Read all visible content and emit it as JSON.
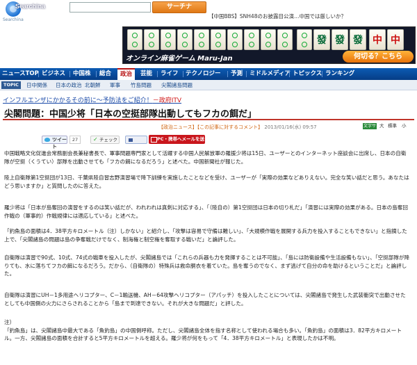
{
  "header": {
    "logo_text": "Searchina",
    "logo_sub": "Searchina",
    "search_button": "サーチナ",
    "ticker": "【中国BBS】SNH48のお披露目公演…中国では厳しいか？"
  },
  "banner": {
    "title": "オンライン麻雀ゲーム Maru-Jan",
    "cta": "何切る？こちら",
    "colors": {
      "bg": "#12182a",
      "cta": "#e8720a"
    }
  },
  "nav": {
    "items": [
      "ニュースTOP",
      "ビジネス",
      "中国株",
      "総合",
      "政治",
      "芸能",
      "ライフ",
      "テクノロジー",
      "予測",
      "ミドルメディア",
      "トピックス",
      "ランキング"
    ],
    "active": "政治"
  },
  "subnav": {
    "label": "TOPIC",
    "items": [
      "日中関係",
      "日本の政治",
      "北朝鮮",
      "軍事",
      "竹島問題",
      "尖閣諸島問題"
    ]
  },
  "promo": {
    "text": "インフルエンザにかかるその前に～予防法をご紹介！",
    "suffix": "－政府ITV"
  },
  "article": {
    "headline": "尖閣問題：中国少将「日本の空挺部隊出動してもフカの餌だ」",
    "meta_source": "【政治ニュース】",
    "meta_comment": "【この記事に対するコメント】",
    "meta_date": "2013/01/16(水) 09:57",
    "font_size_label": "文字サイズ",
    "font_sizes": [
      "大",
      "標準",
      "小"
    ],
    "share": {
      "tweet": "ツイート",
      "tweet_count": "27",
      "check": "チェック",
      "pc_mail": "PC・携帯へメールを送る"
    },
    "paragraphs": [
      "中国戦略文化促進会常務副会長兼秘書長で、軍事問題専門家として活躍する中国人民解放軍の羅援少将は15日、ユーザーとのインターネット座談会に出席し、日本の自衛隊が空挺（くうてい）部隊を出動させても「フカの餌になるだろう」と述べた。中国新聞社が報じた。",
      "陸上自衛隊第1空挺団が13日、千葉県陸自習志野演習場で降下訓練を実施したことなどを受け、ユーザーが「実際の効果などありえない。完全な笑い話だと思う。あなたはどう思いますか」と質問したのに答えた。",
      "羅少将は「日本が島奪回の演習をするのは笑い話だが、われわれは真剣に対応する」、「（陸自の）第1空挺団は日本の切り札だ」「演習には実際の効果がある。日本の島奪回作戦の（軍事的）作戦規律には適応している」と述べた。",
      "「釣魚島の面積は4．38平方キロメートル（注）しかない」と紹介し、「攻撃は容易で守備は難しい」、「大規模作戦を展開する兵力を投入することもできない」と指摘した上で、「尖閣諸島の問題は島の争奪戦だけでなく、制海権と制空権を奪取する戦いだ」と論評した。",
      "自衛隊は演習で90式、10式、74式の戦車を投入したが、尖閣諸島では「これらの兵器も力を発揮することは不可能」、「島には防衛設備や生活設備もない」、「空挺部隊が降りても、水に落ちてフカの餌になるだろう。だから、（自衛隊の）特殊兵は救命胴衣を着ていた。島を奪うのでなく、まず逃げて自分の命を助けるということだ」と論評した。",
      "自衛隊は演習にUH－1多用途ヘリコプター、C－1輸送機、AH－64攻撃ヘリコプター（アパッチ）を投入したことについては、尖閣諸島で発生した武装衝突で出動させたとしても中国側の火力にさらされることから「島まで到達できない。それが大きな問題だ」と評した。",
      "注）\n「釣魚島」は、尖閣諸島中最大である「魚釣島」の中国側呼称。ただし、尖閣諸島全体を指す名称として使われる場合も多い。「魚釣島」の面積は3．82平方キロメートル。一方、尖閣諸島の面積を合計すると5平方キロメートルを超える。羅少将が何をもって「4．38平方キロメートル」と表現したかは不明。"
    ]
  }
}
